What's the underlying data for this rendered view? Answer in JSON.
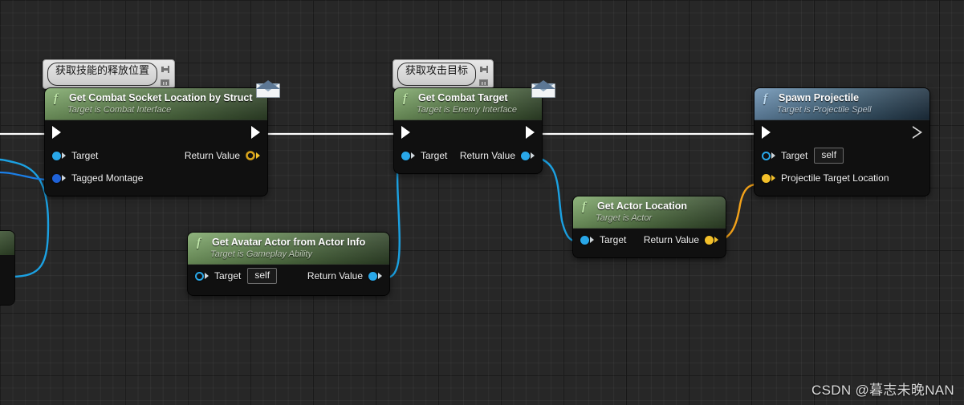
{
  "app": {
    "context": "Unreal Engine Blueprint Graph",
    "watermark": "CSDN @暮志未晚NAN"
  },
  "comments": [
    {
      "text": "获取技能的释放位置",
      "pin_icon": "pin-icon",
      "keyboard_icon": "keyboard-icon"
    },
    {
      "text": "获取攻击目标",
      "pin_icon": "pin-icon",
      "keyboard_icon": "keyboard-icon"
    }
  ],
  "nodes": [
    {
      "id": "get-combat-socket-location-by-struct",
      "title": "Get Combat Socket Location by Struct",
      "subtitle": "Target is Combat Interface",
      "fn_glyph": "f",
      "header_color": "#5c7f4c",
      "badge": "envelope-icon",
      "exec_in": true,
      "exec_out": true,
      "inputs": [
        {
          "label": "Target",
          "pin": "blue",
          "value": ""
        },
        {
          "label": "Tagged Montage",
          "pin": "navy",
          "value": ""
        }
      ],
      "outputs": [
        {
          "label": "Return Value",
          "pin": "yellow-hollow"
        }
      ]
    },
    {
      "id": "get-combat-target",
      "title": "Get Combat Target",
      "subtitle": "Target is Enemy Interface",
      "fn_glyph": "f",
      "header_color": "#5c7f4c",
      "badge": "envelope-icon",
      "exec_in": true,
      "exec_out": true,
      "inputs": [
        {
          "label": "Target",
          "pin": "blue",
          "value": ""
        }
      ],
      "outputs": [
        {
          "label": "Return Value",
          "pin": "blue"
        }
      ]
    },
    {
      "id": "spawn-projectile",
      "title": "Spawn Projectile",
      "subtitle": "Target is Projectile Spell",
      "fn_glyph": "f",
      "header_color": "#456880",
      "badge": "",
      "exec_in": true,
      "exec_out": true,
      "inputs": [
        {
          "label": "Target",
          "pin": "blue-hollow",
          "value": "self"
        },
        {
          "label": "Projectile Target Location",
          "pin": "yellow",
          "value": ""
        }
      ],
      "outputs": []
    },
    {
      "id": "get-actor-location",
      "title": "Get Actor Location",
      "subtitle": "Target is Actor",
      "fn_glyph": "f",
      "header_color": "#5c7f4c",
      "badge": "",
      "exec_in": false,
      "exec_out": false,
      "inputs": [
        {
          "label": "Target",
          "pin": "blue",
          "value": ""
        }
      ],
      "outputs": [
        {
          "label": "Return Value",
          "pin": "yellow"
        }
      ]
    },
    {
      "id": "get-avatar-actor-from-actor-info",
      "title": "Get Avatar Actor from Actor Info",
      "subtitle": "Target is Gameplay Ability",
      "fn_glyph": "f",
      "header_color": "#5c7f4c",
      "badge": "",
      "exec_in": false,
      "exec_out": false,
      "inputs": [
        {
          "label": "Target",
          "pin": "blue-hollow",
          "value": "self"
        }
      ],
      "outputs": [
        {
          "label": "Return Value",
          "pin": "blue"
        }
      ]
    }
  ],
  "wire_colors": {
    "exec": "#ffffff",
    "object": "#1ba1e2",
    "struct": "#1f62d8",
    "vector": "#f3c02a"
  }
}
